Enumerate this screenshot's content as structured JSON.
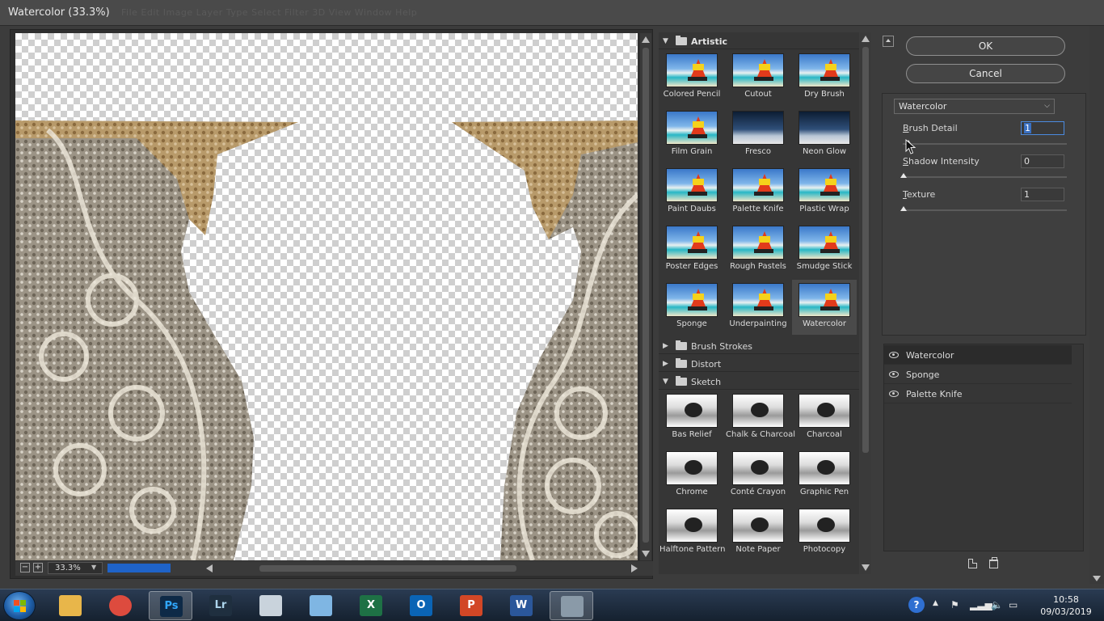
{
  "window": {
    "title": "Watercolor (33.3%)",
    "ghost_menu": "File   Edit   Image   Layer   Type   Select   Filter   3D   View   Window   Help"
  },
  "preview": {
    "zoom": "33.3%",
    "zoom_minus": "−",
    "zoom_plus": "+"
  },
  "gallery": {
    "categories": [
      {
        "label": "Artistic",
        "open": true
      },
      {
        "label": "Brush Strokes",
        "open": false
      },
      {
        "label": "Distort",
        "open": false
      },
      {
        "label": "Sketch",
        "open": true
      }
    ],
    "artistic": [
      "Colored Pencil",
      "Cutout",
      "Dry Brush",
      "Film Grain",
      "Fresco",
      "Neon Glow",
      "Paint Daubs",
      "Palette Knife",
      "Plastic Wrap",
      "Poster Edges",
      "Rough Pastels",
      "Smudge Stick",
      "Sponge",
      "Underpainting",
      "Watercolor"
    ],
    "sketch": [
      "Bas Relief",
      "Chalk & Charcoal",
      "Charcoal",
      "Chrome",
      "Conté Crayon",
      "Graphic Pen",
      "Halftone Pattern",
      "Note Paper",
      "Photocopy"
    ],
    "selected": "Watercolor"
  },
  "buttons": {
    "ok": "OK",
    "cancel": "Cancel"
  },
  "settings": {
    "filter_select": "Watercolor",
    "params": [
      {
        "label_u": "B",
        "label_rest": "rush Detail",
        "value": "1"
      },
      {
        "label_u": "S",
        "label_rest": "hadow Intensity",
        "value": "0"
      },
      {
        "label_u": "T",
        "label_rest": "exture",
        "value": "1"
      }
    ]
  },
  "layers": [
    "Watercolor",
    "Sponge",
    "Palette Knife"
  ],
  "taskbar": {
    "time": "10:58",
    "date": "09/03/2019",
    "apps": [
      {
        "name": "explorer",
        "label": ""
      },
      {
        "name": "chrome",
        "label": ""
      },
      {
        "name": "photoshop",
        "label": "Ps"
      },
      {
        "name": "lightroom",
        "label": "Lr"
      },
      {
        "name": "snipping",
        "label": ""
      },
      {
        "name": "notepad",
        "label": ""
      },
      {
        "name": "excel",
        "label": "X"
      },
      {
        "name": "outlook",
        "label": "O"
      },
      {
        "name": "powerpoint",
        "label": "P"
      },
      {
        "name": "word",
        "label": "W"
      },
      {
        "name": "calculator",
        "label": ""
      }
    ]
  },
  "colors": {
    "selection_blue": "#1f63c8",
    "panel_bg": "#3c3c3c"
  }
}
